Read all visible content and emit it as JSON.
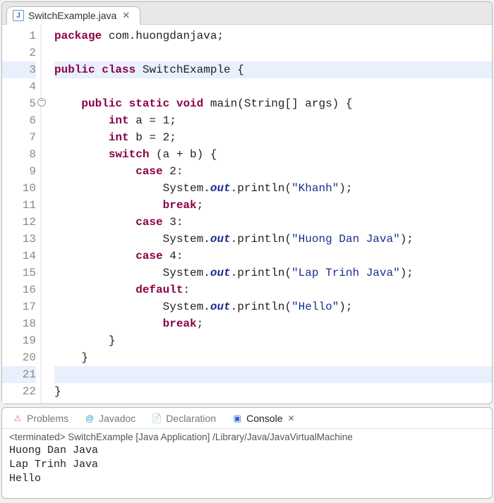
{
  "editor": {
    "tab": {
      "filename": "SwitchExample.java"
    },
    "fold_line": 5,
    "highlight_lines": [
      3,
      21
    ],
    "lines": [
      {
        "n": 1,
        "tokens": [
          [
            "kw",
            "package"
          ],
          [
            "",
            " com.huongdanjava;"
          ]
        ]
      },
      {
        "n": 2,
        "tokens": []
      },
      {
        "n": 3,
        "tokens": [
          [
            "kw",
            "public"
          ],
          [
            "",
            " "
          ],
          [
            "kw",
            "class"
          ],
          [
            "",
            " SwitchExample {"
          ]
        ]
      },
      {
        "n": 4,
        "tokens": []
      },
      {
        "n": 5,
        "tokens": [
          [
            "",
            "    "
          ],
          [
            "kw",
            "public"
          ],
          [
            "",
            " "
          ],
          [
            "kw",
            "static"
          ],
          [
            "",
            " "
          ],
          [
            "kw",
            "void"
          ],
          [
            "",
            " main(String[] args) {"
          ]
        ]
      },
      {
        "n": 6,
        "tokens": [
          [
            "",
            "        "
          ],
          [
            "type",
            "int"
          ],
          [
            "",
            " a = 1;"
          ]
        ]
      },
      {
        "n": 7,
        "tokens": [
          [
            "",
            "        "
          ],
          [
            "type",
            "int"
          ],
          [
            "",
            " b = 2;"
          ]
        ]
      },
      {
        "n": 8,
        "tokens": [
          [
            "",
            "        "
          ],
          [
            "kw",
            "switch"
          ],
          [
            "",
            " (a + b) {"
          ]
        ]
      },
      {
        "n": 9,
        "tokens": [
          [
            "",
            "            "
          ],
          [
            "kw",
            "case"
          ],
          [
            "",
            " 2:"
          ]
        ]
      },
      {
        "n": 10,
        "tokens": [
          [
            "",
            "                System."
          ],
          [
            "field-static",
            "out"
          ],
          [
            "",
            ".println("
          ],
          [
            "str",
            "\"Khanh\""
          ],
          [
            "",
            ");"
          ]
        ]
      },
      {
        "n": 11,
        "tokens": [
          [
            "",
            "                "
          ],
          [
            "kw",
            "break"
          ],
          [
            "",
            ";"
          ]
        ]
      },
      {
        "n": 12,
        "tokens": [
          [
            "",
            "            "
          ],
          [
            "kw",
            "case"
          ],
          [
            "",
            " 3:"
          ]
        ]
      },
      {
        "n": 13,
        "tokens": [
          [
            "",
            "                System."
          ],
          [
            "field-static",
            "out"
          ],
          [
            "",
            ".println("
          ],
          [
            "str",
            "\"Huong Dan Java\""
          ],
          [
            "",
            ");"
          ]
        ]
      },
      {
        "n": 14,
        "tokens": [
          [
            "",
            "            "
          ],
          [
            "kw",
            "case"
          ],
          [
            "",
            " 4:"
          ]
        ]
      },
      {
        "n": 15,
        "tokens": [
          [
            "",
            "                System."
          ],
          [
            "field-static",
            "out"
          ],
          [
            "",
            ".println("
          ],
          [
            "str",
            "\"Lap Trinh Java\""
          ],
          [
            "",
            ");"
          ]
        ]
      },
      {
        "n": 16,
        "tokens": [
          [
            "",
            "            "
          ],
          [
            "kw",
            "default"
          ],
          [
            "",
            ":"
          ]
        ]
      },
      {
        "n": 17,
        "tokens": [
          [
            "",
            "                System."
          ],
          [
            "field-static",
            "out"
          ],
          [
            "",
            ".println("
          ],
          [
            "str",
            "\"Hello\""
          ],
          [
            "",
            ");"
          ]
        ]
      },
      {
        "n": 18,
        "tokens": [
          [
            "",
            "                "
          ],
          [
            "kw",
            "break"
          ],
          [
            "",
            ";"
          ]
        ]
      },
      {
        "n": 19,
        "tokens": [
          [
            "",
            "        }"
          ]
        ]
      },
      {
        "n": 20,
        "tokens": [
          [
            "",
            "    }"
          ]
        ]
      },
      {
        "n": 21,
        "tokens": []
      },
      {
        "n": 22,
        "tokens": [
          [
            "",
            "}"
          ]
        ]
      }
    ]
  },
  "bottom": {
    "tabs": {
      "problems": "Problems",
      "javadoc": "Javadoc",
      "declaration": "Declaration",
      "console": "Console"
    },
    "active": "console",
    "console_status": "<terminated> SwitchExample [Java Application] /Library/Java/JavaVirtualMachine",
    "console_output": "Huong Dan Java\nLap Trinh Java\nHello"
  }
}
